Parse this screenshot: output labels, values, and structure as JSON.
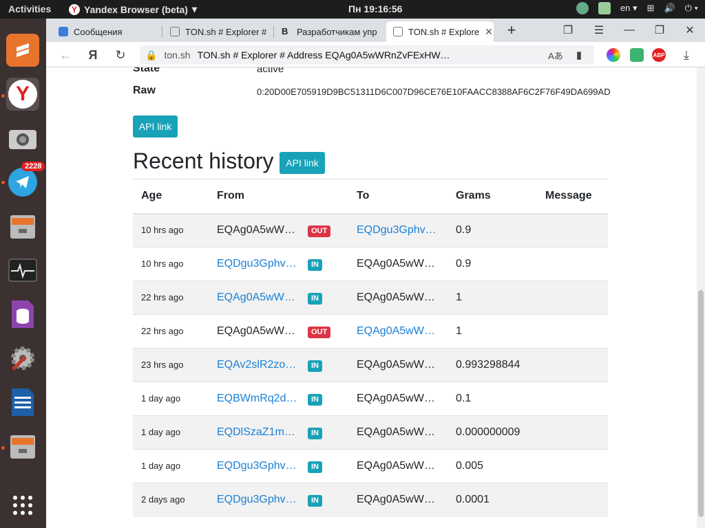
{
  "topbar": {
    "activities": "Activities",
    "app_name": "Yandex Browser (beta)",
    "clock": "Пн 19:16:56",
    "lang": "en"
  },
  "dock": {
    "telegram_badge": "2228"
  },
  "tabs": [
    {
      "label": "Сообщения"
    },
    {
      "label": "TON.sh # Explorer #"
    },
    {
      "label": "Разработчикам упр"
    },
    {
      "label": "TON.sh # Explore"
    }
  ],
  "address_bar": {
    "domain": "ton.sh",
    "page_title": "TON.sh # Explorer # Address EQAg0A5wWRnZvFExHW…"
  },
  "details": {
    "state_label": "State",
    "state_value": "active",
    "raw_label": "Raw",
    "raw_value": "0:20D00E705919D9BC51311D6C007D96CE76E10FAACC8388AF6C2F76F49DA699AD",
    "api_link": "API link"
  },
  "history": {
    "title": "Recent history",
    "api_link": "API link",
    "columns": [
      "Age",
      "From",
      "",
      "To",
      "Grams",
      "Message"
    ],
    "rows": [
      {
        "age": "10 hrs ago",
        "from": "EQAg0A5wW…",
        "dir": "OUT",
        "to": "EQDgu3Gphv…",
        "grams": "0.9",
        "message": ""
      },
      {
        "age": "10 hrs ago",
        "from": "EQDgu3Gphv…",
        "dir": "IN",
        "to": "EQAg0A5wW…",
        "grams": "0.9",
        "message": ""
      },
      {
        "age": "22 hrs ago",
        "from": "EQAg0A5wW…",
        "dir": "IN",
        "to": "EQAg0A5wW…",
        "grams": "1",
        "message": ""
      },
      {
        "age": "22 hrs ago",
        "from": "EQAg0A5wW…",
        "dir": "OUT",
        "to": "EQAg0A5wW…",
        "grams": "1",
        "message": ""
      },
      {
        "age": "23 hrs ago",
        "from": "EQAv2slR2zo…",
        "dir": "IN",
        "to": "EQAg0A5wW…",
        "grams": "0.993298844",
        "message": ""
      },
      {
        "age": "1 day ago",
        "from": "EQBWmRq2d…",
        "dir": "IN",
        "to": "EQAg0A5wW…",
        "grams": "0.1",
        "message": ""
      },
      {
        "age": "1 day ago",
        "from": "EQDlSzaZ1m…",
        "dir": "IN",
        "to": "EQAg0A5wW…",
        "grams": "0.000000009",
        "message": ""
      },
      {
        "age": "1 day ago",
        "from": "EQDgu3Gphv…",
        "dir": "IN",
        "to": "EQAg0A5wW…",
        "grams": "0.005",
        "message": ""
      },
      {
        "age": "2 days ago",
        "from": "EQDgu3Gphv…",
        "dir": "IN",
        "to": "EQAg0A5wW…",
        "grams": "0.0001",
        "message": ""
      }
    ],
    "link_cells": [
      [
        false,
        true
      ],
      [
        true,
        false
      ],
      [
        true,
        false
      ],
      [
        false,
        true
      ],
      [
        true,
        false
      ],
      [
        true,
        false
      ],
      [
        true,
        false
      ],
      [
        true,
        false
      ],
      [
        true,
        false
      ]
    ]
  },
  "colors": {
    "accent": "#17a2b8",
    "out_badge": "#dc3545",
    "link": "#1a7fd6"
  }
}
